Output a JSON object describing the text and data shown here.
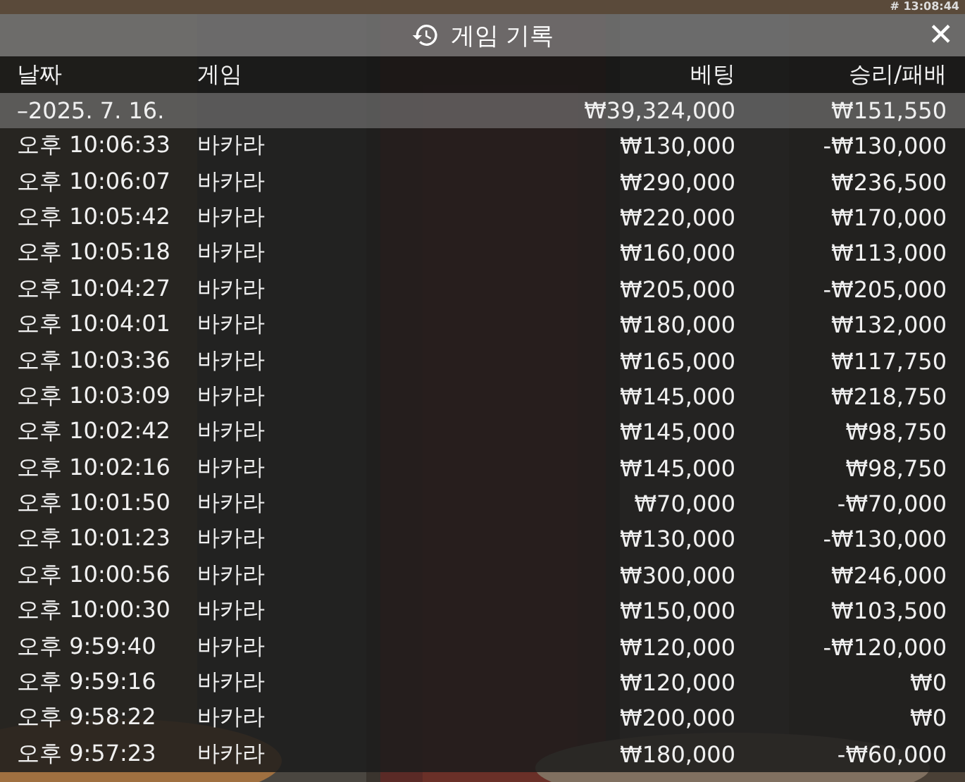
{
  "clock": "# 13:08:44",
  "window": {
    "title": "게임 기록",
    "close": "✕"
  },
  "table": {
    "columns": [
      "날짜",
      "게임",
      "베팅",
      "승리/패배"
    ],
    "group": {
      "date": "–2025. 7. 16.",
      "bet": "₩39,324,000",
      "result": "₩151,550"
    },
    "rows": [
      {
        "time": "오후 10:06:33",
        "game": "바카라",
        "bet": "₩130,000",
        "result": "-₩130,000"
      },
      {
        "time": "오후 10:06:07",
        "game": "바카라",
        "bet": "₩290,000",
        "result": "₩236,500"
      },
      {
        "time": "오후 10:05:42",
        "game": "바카라",
        "bet": "₩220,000",
        "result": "₩170,000"
      },
      {
        "time": "오후 10:05:18",
        "game": "바카라",
        "bet": "₩160,000",
        "result": "₩113,000"
      },
      {
        "time": "오후 10:04:27",
        "game": "바카라",
        "bet": "₩205,000",
        "result": "-₩205,000"
      },
      {
        "time": "오후 10:04:01",
        "game": "바카라",
        "bet": "₩180,000",
        "result": "₩132,000"
      },
      {
        "time": "오후 10:03:36",
        "game": "바카라",
        "bet": "₩165,000",
        "result": "₩117,750"
      },
      {
        "time": "오후 10:03:09",
        "game": "바카라",
        "bet": "₩145,000",
        "result": "₩218,750"
      },
      {
        "time": "오후 10:02:42",
        "game": "바카라",
        "bet": "₩145,000",
        "result": "₩98,750"
      },
      {
        "time": "오후 10:02:16",
        "game": "바카라",
        "bet": "₩145,000",
        "result": "₩98,750"
      },
      {
        "time": "오후 10:01:50",
        "game": "바카라",
        "bet": "₩70,000",
        "result": "-₩70,000"
      },
      {
        "time": "오후 10:01:23",
        "game": "바카라",
        "bet": "₩130,000",
        "result": "-₩130,000"
      },
      {
        "time": "오후 10:00:56",
        "game": "바카라",
        "bet": "₩300,000",
        "result": "₩246,000"
      },
      {
        "time": "오후 10:00:30",
        "game": "바카라",
        "bet": "₩150,000",
        "result": "₩103,500"
      },
      {
        "time": "오후 9:59:40",
        "game": "바카라",
        "bet": "₩120,000",
        "result": "-₩120,000"
      },
      {
        "time": "오후 9:59:16",
        "game": "바카라",
        "bet": "₩120,000",
        "result": "₩0"
      },
      {
        "time": "오후 9:58:22",
        "game": "바카라",
        "bet": "₩200,000",
        "result": "₩0"
      },
      {
        "time": "오후 9:57:23",
        "game": "바카라",
        "bet": "₩180,000",
        "result": "-₩60,000"
      }
    ]
  }
}
